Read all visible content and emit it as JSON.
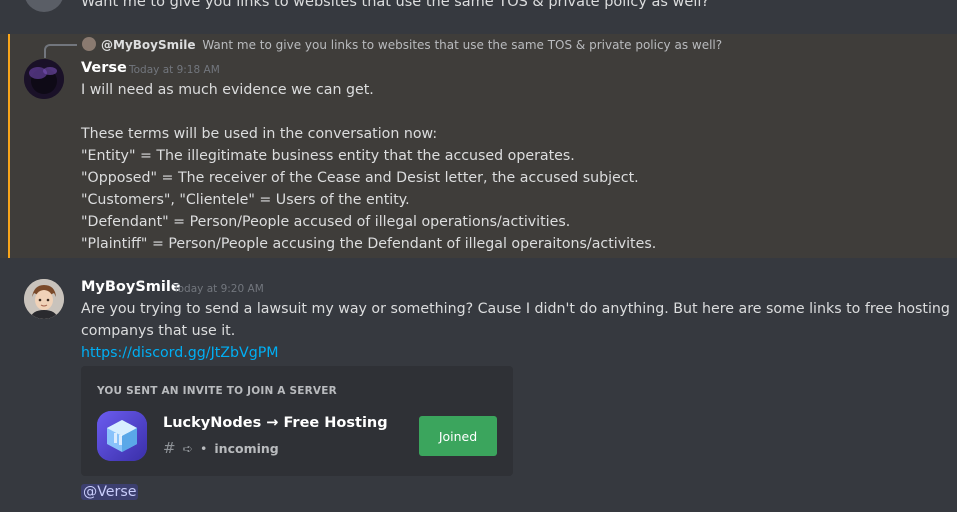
{
  "top_message": {
    "text": "Want me to give you links to websites that use the same TOS & private policy as well?"
  },
  "reply_preview": {
    "author": "@MyBoySmile",
    "text": "Want me to give you links to websites that use the same TOS & private policy as well?"
  },
  "verse_message": {
    "author": "Verse",
    "timestamp": "Today at 9:18 AM",
    "lines": [
      "I will need as much evidence we can get.",
      "These terms will be used in the conversation now:",
      "\"Entity\" = The illegitimate business entity that the accused operates.",
      "\"Opposed\" = The receiver of the Cease and Desist letter, the accused subject.",
      "\"Customers\", \"Clientele\" = Users of the entity.",
      "\"Defendant\" = Person/People accused of illegal operations/activities.",
      "\"Plaintiff\" = Person/People accusing the Defendant of illegal operaitons/activites."
    ]
  },
  "myboysmile_message": {
    "author": "MyBoySmile",
    "timestamp": "Today at 9:20 AM",
    "lines": [
      "Are you trying to send a lawsuit my way or something? Cause I didn't do anything. But here are some links to free hosting",
      "companys that use it."
    ],
    "link": "https://discord.gg/JtZbVgPM"
  },
  "invite": {
    "header": "YOU SENT AN INVITE TO JOIN A SERVER",
    "server_name": "LuckyNodes → Free Hosting",
    "channel": "incoming",
    "button_label": "Joined"
  },
  "mention": "@Verse",
  "colors": {
    "background": "#36393f",
    "highlight": "#3f3d3a",
    "highlight_bar": "#faa61a",
    "link": "#00aff4",
    "joined_button": "#3ba55d",
    "mention_bg": "#3c3f6f"
  }
}
